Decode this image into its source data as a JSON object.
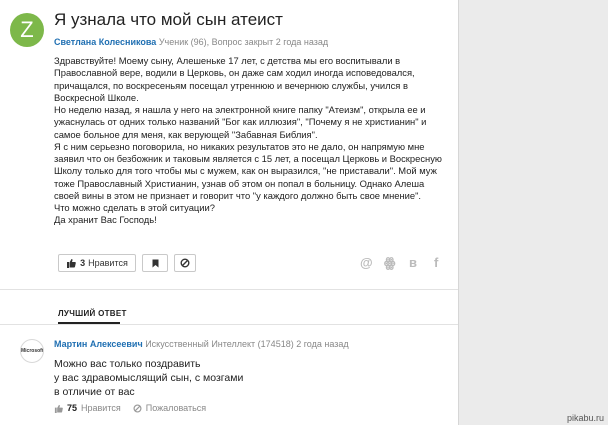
{
  "question": {
    "avatar_letter": "Z",
    "title": "Я узнала что мой сын атеист",
    "author": "Светлана Колесникова",
    "meta": "Ученик (96), Вопрос закрыт 2 года назад",
    "body": [
      "Здравствуйте! Моему сыну, Алешеньке 17 лет, с детства мы его воспитывали в",
      "Православной вере, водили в Церковь, он даже сам ходил иногда исповедовался,",
      "причащался, по воскресеньям посещал утреннюю и вечернюю службы, учился в",
      "Воскресной Школе.",
      "Но неделю назад, я нашла у него на электронной книге папку \"Атеизм\", открыла ее и",
      "ужаснулась от одних только названий \"Бог как иллюзия\", \"Почему я не христианин\" и",
      "самое больное для меня, как верующей \"Забавная Библия\".",
      "Я с ним серьезно поговорила, но никаких результатов это не дало, он напрямую мне",
      "заявил что он безбожник и таковым является с 15 лет, а посещал Церковь и Воскресную",
      "Школу только для того чтобы мы с мужем, как он выразился, \"не приставали\". Мой муж",
      "тоже Православный Христианин, узнав об этом он попал в больницу. Однако Алеша",
      "своей вины в этом не признает и говорит что \"у каждого должно быть свое мнение\".",
      "Что можно сделать в этой ситуации?",
      "Да хранит Вас Господь!"
    ],
    "like_count": "3",
    "like_label": "Нравится"
  },
  "icons": {
    "like": "thumbs-up-icon",
    "flag": "flag-icon",
    "block": "block-icon",
    "mail": "mail-at-icon",
    "ok": "odnoklassniki-icon",
    "vk": "vk-icon",
    "fb": "facebook-icon"
  },
  "social": {
    "mail": "@",
    "ok": "ꙮ",
    "vk": "в",
    "fb": "f"
  },
  "best_answer": {
    "label": "ЛУЧШИЙ ОТВЕТ",
    "avatar_text": "Microsoft",
    "author": "Мартин Алексеевич",
    "meta": "Искусственный Интеллект (174518) 2 года назад",
    "body": [
      "Можно вас только поздравить",
      "у вас здравомыслящий сын, с мозгами",
      "в отличие от вас"
    ],
    "like_count": "75",
    "like_label": "Нравится",
    "report_label": "Пожаловаться"
  },
  "watermark": "pikabu.ru",
  "colors": {
    "accent": "#1f6fb2",
    "avatar_bg": "#7db84a"
  }
}
